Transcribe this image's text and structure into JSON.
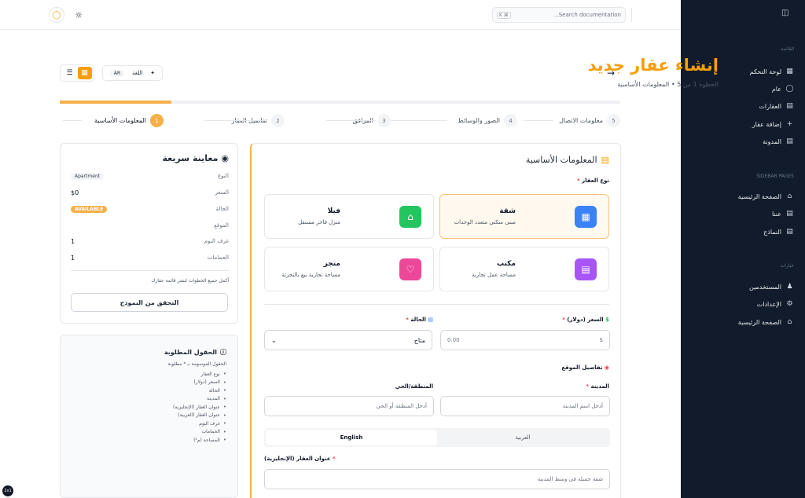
{
  "topbar": {
    "search_placeholder": "Search documentation...",
    "search_kbd": "⌘ K"
  },
  "sidebar": {
    "section_menu": "القائمة",
    "menu_items": [
      {
        "label": "لوحة التحكم",
        "icon": "dashboard-icon"
      },
      {
        "label": "عام",
        "icon": "globe-icon"
      },
      {
        "label": "العقارات",
        "icon": "building-icon"
      },
      {
        "label": "إضافة عقار",
        "icon": "plus-icon"
      },
      {
        "label": "المدونة",
        "icon": "document-icon"
      }
    ],
    "section_pages": "SIDEBAR PAGES",
    "page_items": [
      {
        "label": "الصفحة الرئيسية",
        "icon": "home-icon"
      },
      {
        "label": "عننا",
        "icon": "file-icon"
      },
      {
        "label": "النماذج",
        "icon": "file-icon"
      }
    ],
    "section_options": "خيارات",
    "option_items": [
      {
        "label": "المستخدمين",
        "icon": "users-icon"
      },
      {
        "label": "الإعدادات",
        "icon": "gear-icon"
      },
      {
        "label": "الصفحة الرئيسية",
        "icon": "home-icon"
      }
    ]
  },
  "header": {
    "title": "إنشاء عقار جديد",
    "subtitle": "الخطوة 1 من 5 • المعلومات الأساسية",
    "language_label": "اللغة",
    "language_value": "AR"
  },
  "steps": [
    {
      "num": "1",
      "label": "المعلومات الأساسية"
    },
    {
      "num": "2",
      "label": "تفاصيل العقار"
    },
    {
      "num": "3",
      "label": "المرافق"
    },
    {
      "num": "4",
      "label": "الصور والوسائط"
    },
    {
      "num": "5",
      "label": "معلومات الاتصال"
    }
  ],
  "progress": {
    "fraction": 0.2
  },
  "preview": {
    "title": "معاينة سريعة",
    "type_label": "النوع",
    "type_value": "Apartment",
    "price_label": "السعر",
    "price_value": "$0",
    "status_label": "الحالة",
    "status_value": "AVAILABLE",
    "location_label": "الموقع",
    "bedrooms_label": "غرف النوم",
    "bedrooms_value": "1",
    "bathrooms_label": "الحمامات",
    "bathrooms_value": "1",
    "note": "أكمل جميع الخطوات لنشر قائمة عقارك",
    "validate_button": "التحقق من النموذج"
  },
  "required": {
    "title": "الحقول المطلوبة",
    "subtitle": "الحقول الموسومة بـ * مطلوبة",
    "items": [
      "نوع العقار",
      "السعر (دولار)",
      "الحالة",
      "المدينة",
      "عنوان العقار (الإنجليزية)",
      "عنوان العقار (العربية)",
      "غرف النوم",
      "الحمامات",
      "المساحة (م²)"
    ]
  },
  "form": {
    "section_title": "المعلومات الأساسية",
    "type_label": "نوع العقار",
    "types": [
      {
        "name": "شقة",
        "desc": "مبنى سكني متعدد الوحدات",
        "color": "#3b82f6",
        "icon": "building-icon",
        "selected": true
      },
      {
        "name": "فيلا",
        "desc": "منزل فاخر مستقل",
        "color": "#22c55e",
        "icon": "home-icon",
        "selected": false
      },
      {
        "name": "مكتب",
        "desc": "مساحة عمل تجارية",
        "color": "#a855f7",
        "icon": "office-icon",
        "selected": false
      },
      {
        "name": "متجر",
        "desc": "مساحة تجارية بيع بالتجزئة",
        "color": "#ec4899",
        "icon": "heart-icon",
        "selected": false
      }
    ],
    "price_label": "السعر (دولار)",
    "price_value": "0.00",
    "price_prefix": "$",
    "status_label": "الحالة",
    "status_value": "متاح",
    "location_title": "تفاصيل الموقع",
    "city_label": "المدينة",
    "city_placeholder": "أدخل اسم المدينة",
    "district_label": "المنطقة/الحي",
    "district_placeholder": "أدخل المنطقة أو الحي",
    "tab_arabic": "العربية",
    "tab_english": "English",
    "title_en_label": "عنوان العقار (الإنجليزية)",
    "title_en_placeholder": "شقة جميلة في وسط المدينة"
  },
  "corner_badge": "2x1"
}
